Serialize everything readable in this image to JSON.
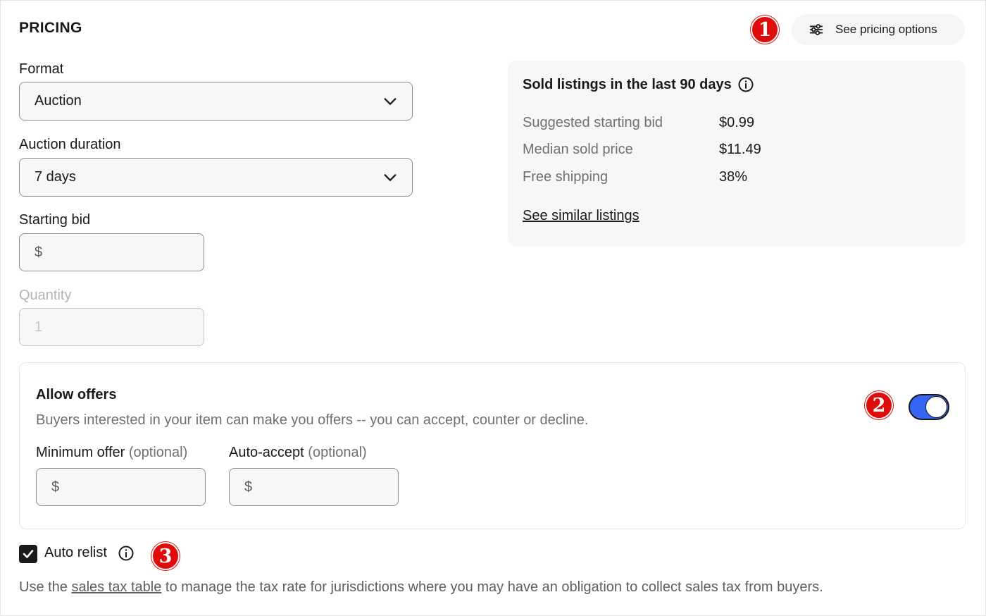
{
  "section": {
    "title": "PRICING"
  },
  "badges": [
    "1",
    "2",
    "3"
  ],
  "pricing_options_button": {
    "label": "See pricing options",
    "icon": "sliders-icon"
  },
  "format": {
    "label": "Format",
    "value": "Auction"
  },
  "duration": {
    "label": "Auction duration",
    "value": "7 days"
  },
  "starting_bid": {
    "label": "Starting bid",
    "currency": "$",
    "value": ""
  },
  "quantity": {
    "label": "Quantity",
    "value": "1",
    "disabled": true
  },
  "sold_panel": {
    "title": "Sold listings in the last 90 days",
    "stats": [
      {
        "label": "Suggested starting bid",
        "value": "$0.99"
      },
      {
        "label": "Median sold price",
        "value": "$11.49"
      },
      {
        "label": "Free shipping",
        "value": "38%"
      }
    ],
    "link": "See similar listings"
  },
  "offers": {
    "title": "Allow offers",
    "description": "Buyers interested in your item can make you offers -- you can accept, counter or decline.",
    "toggle_on": true,
    "minimum": {
      "label": "Minimum offer",
      "optional": "(optional)",
      "currency": "$"
    },
    "auto_accept": {
      "label": "Auto-accept",
      "optional": "(optional)",
      "currency": "$"
    }
  },
  "auto_relist": {
    "label": "Auto relist",
    "checked": true
  },
  "footnote": {
    "prefix": "Use the ",
    "link": "sales tax table",
    "suffix": " to manage the tax rate for jurisdictions where you may have an obligation to collect sales tax from buyers."
  },
  "colors": {
    "accent": "#3665f3",
    "badge": "#e00b0b",
    "panel_bg": "#f7f7f7"
  }
}
